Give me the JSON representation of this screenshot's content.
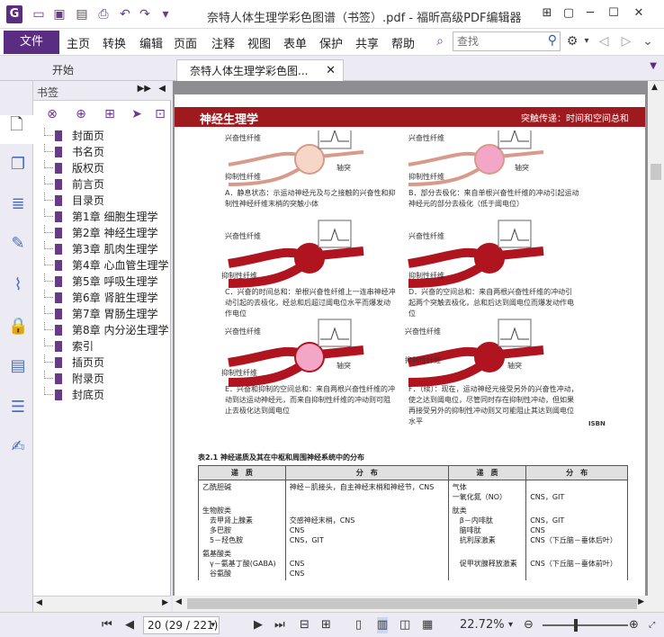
{
  "titlebar": {
    "title": "奈特人体生理学彩色图谱（书签）.pdf - 福昕高级PDF编辑器",
    "logo": "G"
  },
  "menu": {
    "file": "文件",
    "items": [
      "主页",
      "转换",
      "编辑",
      "页面",
      "注释",
      "视图",
      "表单",
      "保护",
      "共享",
      "帮助"
    ],
    "search_placeholder": "查找"
  },
  "tabs": {
    "start": "开始",
    "doc": "奈特人体生理学彩色图..."
  },
  "panel": {
    "title": "书签"
  },
  "bookmarks": [
    "封面页",
    "书名页",
    "版权页",
    "前言页",
    "目录页",
    "第1章 细胞生理学",
    "第2章 神经生理学",
    "第3章 肌肉生理学",
    "第4章 心血管生理学",
    "第5章 呼吸生理学",
    "第6章 肾脏生理学",
    "第7章 胃肠生理学",
    "第8章 内分泌生理学",
    "索引",
    "插页页",
    "附录页",
    "封底页"
  ],
  "status": {
    "page": "20 (29 / 221)",
    "zoom": "22.72%"
  },
  "pdf": {
    "header_left": "神经生理学",
    "header_right": "突触传递：时间和空间总和",
    "label_excit": "兴奋性纤维",
    "label_inhib": "抑制性纤维",
    "label_axon": "轴突",
    "captions": {
      "A": "A．静息状态：示运动神经元及与之接触的兴奋性和抑制性神经纤维末梢的突触小体",
      "B": "B．部分去极化：来自单根兴奋性纤维的冲动引起运动神经元的部分去极化（低于阈电位）",
      "C": "C．兴奋的时间总和：单根兴奋性纤维上一连串神经冲动引起的去极化，经总和后超过阈电位水平而爆发动作电位",
      "D": "D．兴奋的空间总和：来自两根兴奋性纤维的冲动引起两个突触去极化，总和后达到阈电位而爆发动作电位",
      "E": "E．兴奋和抑制的空间总和：来自两根兴奋性纤维的冲动到达运动神经元，而来自抑制性纤维的冲动则可阻止去极化达到阈电位",
      "F": "F．（续）：现在，运动神经元接受另外的兴奋性冲动，使之达到阈电位，尽管同时存在抑制性冲动，但如果再接受另外的抑制性冲动则又可能阻止其达到阈电位水平"
    },
    "table_caption": "表2.1  神经递质及其在中枢和周围神经系统中的分布",
    "table_headers": [
      "递　质",
      "分　布",
      "递　质",
      "分　布"
    ],
    "table_rows": [
      [
        "乙酰胆碱",
        "神经－肌接头，自主神经末梢和神经节，CNS",
        "气体\n一氧化氮（NO）",
        "\nCNS，GIT"
      ],
      [
        "生物胺类\n　去甲肾上腺素\n　多巴胺\n　5－羟色胺",
        "\n交感神经末梢，CNS\nCNS\nCNS，GIT",
        "肽类\n　β－内啡肽\n　脑啡肽\n　抗利尿激素",
        "\nCNS，GIT\nCNS\nCNS（下丘脑－垂体后叶）"
      ],
      [
        "氨基酸类\n　γ－氨基丁酸(GABA)\n　谷氨酸",
        "\nCNS\nCNS",
        "\n　促甲状腺释放激素",
        "\nCNS（下丘脑－垂体前叶）"
      ]
    ],
    "logo_text": "ISBN"
  },
  "colors": {
    "brand": "#5b2d82",
    "header_red": "#9f1a1f",
    "nerve_red": "#b0141e",
    "pink": "#f4a6c8"
  }
}
